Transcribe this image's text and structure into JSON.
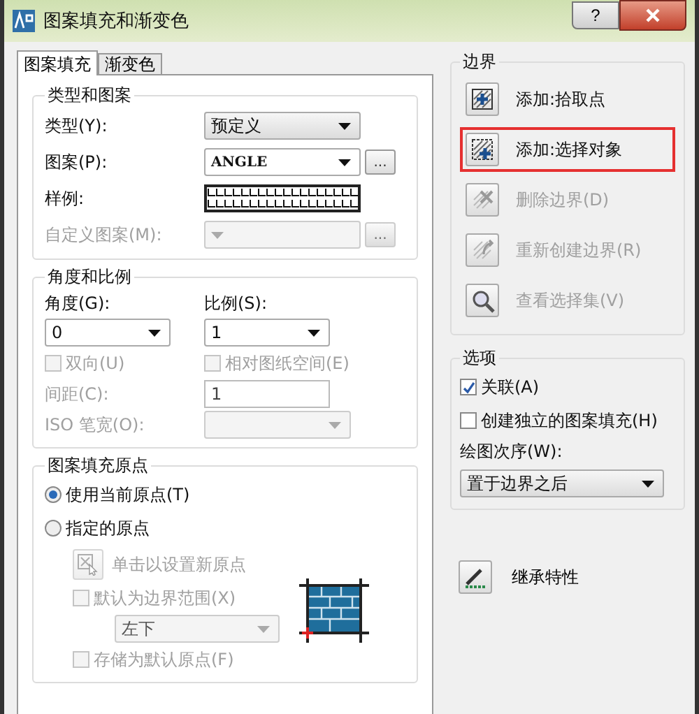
{
  "window": {
    "title": "图案填充和渐变色",
    "help": "?"
  },
  "tabs": [
    {
      "label": "图案填充",
      "selected": true
    },
    {
      "label": "渐变色",
      "selected": false
    }
  ],
  "type_and_pattern": {
    "title": "类型和图案",
    "type": {
      "label": "类型(Y):",
      "value": "预定义"
    },
    "pattern": {
      "label": "图案(P):",
      "value": "ANGLE",
      "browse": "..."
    },
    "swatch": {
      "label": "样例:"
    },
    "custom": {
      "label": "自定义图案(M):",
      "disabled": true,
      "browse": "..."
    }
  },
  "angle_and_scale": {
    "title": "角度和比例",
    "angle": {
      "label": "角度(G):",
      "value": "0"
    },
    "scale": {
      "label": "比例(S):",
      "value": "1"
    },
    "checkboxes": [
      {
        "label": "双向(U)",
        "checked": false,
        "disabled": true
      },
      {
        "label": "相对图纸空间(E)",
        "checked": false,
        "disabled": true
      }
    ],
    "spacing": {
      "label": "间距(C):",
      "value": "1",
      "disabled": true
    },
    "pen_width": {
      "label": "ISO 笔宽(O):",
      "disabled": true
    }
  },
  "origin": {
    "title": "图案填充原点",
    "radios": [
      {
        "label": "使用当前原点(T)",
        "selected": true
      },
      {
        "label": "指定的原点",
        "selected": false
      }
    ],
    "click_button": {
      "label": "单击以设置新原点",
      "disabled": true
    },
    "default_extent": {
      "label": "默认为边界范围(X)",
      "checked": false,
      "disabled": true
    },
    "position": {
      "value": "左下",
      "disabled": true
    },
    "store_default": {
      "label": "存储为默认原点(F)",
      "checked": false,
      "disabled": true
    }
  },
  "boundaries": {
    "title": "边界",
    "buttons": [
      {
        "label": "添加:拾取点",
        "kind": "pick",
        "disabled": false,
        "highlighted": false
      },
      {
        "label": "添加:选择对象",
        "kind": "select",
        "disabled": false,
        "highlighted": true
      },
      {
        "label": "删除边界(D)",
        "kind": "remove",
        "disabled": true,
        "highlighted": false
      },
      {
        "label": "重新创建边界(R)",
        "kind": "recreate",
        "disabled": true,
        "highlighted": false
      },
      {
        "label": "查看选择集(V)",
        "kind": "view",
        "disabled": true,
        "highlighted": false
      }
    ]
  },
  "options": {
    "title": "选项",
    "checkboxes": [
      {
        "label": "关联(A)",
        "checked": true,
        "disabled": false
      },
      {
        "label": "创建独立的图案填充(H)",
        "checked": false,
        "disabled": false
      }
    ],
    "draw_order": {
      "label": "绘图次序(W):",
      "value": "置于边界之后"
    }
  },
  "inherit": {
    "label": "继承特性"
  }
}
